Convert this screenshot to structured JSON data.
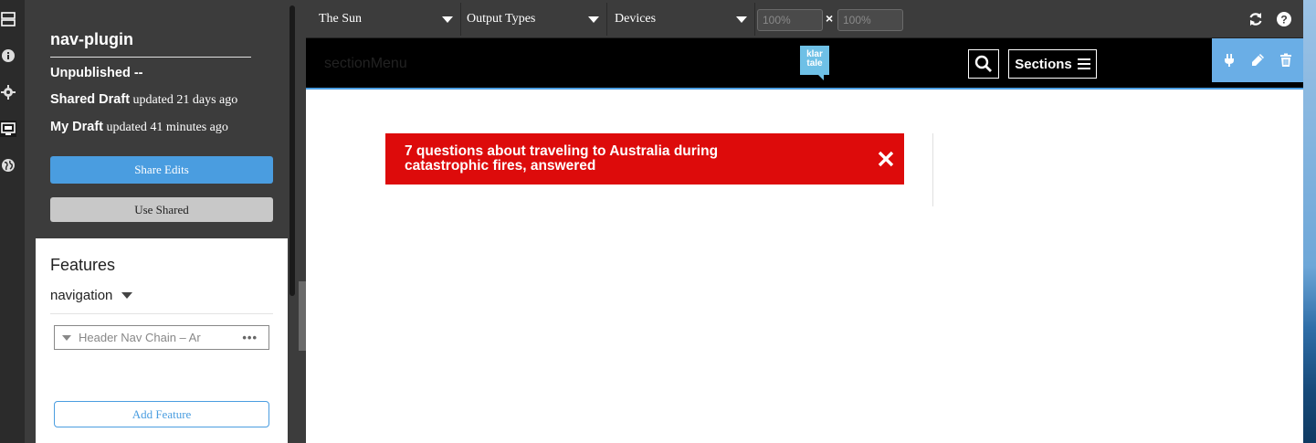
{
  "panel": {
    "plugin_name": "nav-plugin",
    "unpublished_label": "Unpublished --",
    "shared_draft_label": "Shared Draft",
    "shared_draft_time": "updated 21 days ago",
    "my_draft_label": "My Draft",
    "my_draft_time": "updated 41 minutes ago",
    "share_edits_label": "Share Edits",
    "use_shared_label": "Use Shared",
    "features_title": "Features",
    "feature_filter": "navigation",
    "feature_item_label": "Header Nav Chain – Ar",
    "add_feature_label": "Add Feature"
  },
  "toolbar": {
    "site_select": "The Sun",
    "output_types_select": "Output Types",
    "devices_select": "Devices",
    "width_placeholder": "100%",
    "height_placeholder": "100%",
    "times_symbol": "×"
  },
  "preview": {
    "section_menu_text": "sectionMenu",
    "logo_line1": "klar",
    "logo_line2": "tale",
    "sections_label": "Sections",
    "alert_text": "7 questions about traveling to Australia during catastrophic fires, answered"
  },
  "colors": {
    "accent_blue": "#4a9de0",
    "alert_red": "#dd0b0b",
    "panel_dark": "#3c3c3c",
    "logo_blue": "#6ec0e6",
    "feature_actions_blue": "#6aaee6"
  },
  "icons": {
    "rail": [
      "layout-icon",
      "info-icon",
      "gear-icon",
      "gallery-icon",
      "globe-icon"
    ],
    "toolbar": [
      "refresh-icon",
      "help-icon"
    ],
    "feature_actions": [
      "plug-icon",
      "pencil-icon",
      "trash-icon"
    ],
    "header": [
      "search-icon",
      "hamburger-icon"
    ],
    "alert": [
      "close-icon"
    ]
  }
}
